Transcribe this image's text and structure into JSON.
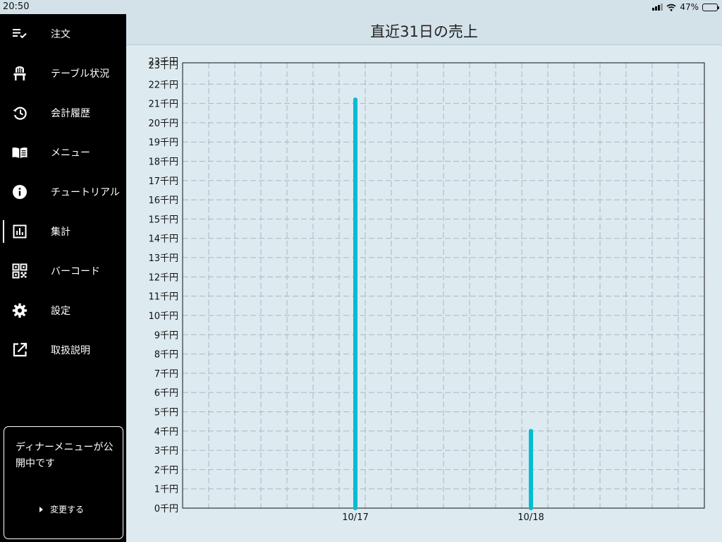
{
  "status_bar": {
    "time": "20:50",
    "battery": "47%",
    "battery_level": 0.47
  },
  "sidebar": {
    "items": [
      {
        "label": "注文",
        "icon": "order-checklist-icon"
      },
      {
        "label": "テーブル状況",
        "icon": "chair-icon"
      },
      {
        "label": "会計履歴",
        "icon": "history-icon"
      },
      {
        "label": "メニュー",
        "icon": "menu-book-icon"
      },
      {
        "label": "チュートリアル",
        "icon": "info-icon"
      },
      {
        "label": "集計",
        "icon": "bar-chart-icon",
        "active": true
      },
      {
        "label": "バーコード",
        "icon": "qr-code-icon"
      },
      {
        "label": "設定",
        "icon": "gear-icon"
      },
      {
        "label": "取扱説明",
        "icon": "external-link-icon"
      }
    ],
    "menu_card": {
      "message": "ディナーメニューが公開中です",
      "change_label": "変更する"
    }
  },
  "header": {
    "title": "直近31日の売上"
  },
  "chart_data": {
    "type": "bar",
    "title": "直近31日の売上",
    "xlabel": "",
    "ylabel": "",
    "ylim": [
      0,
      23000
    ],
    "y_ticks": [
      0,
      1000,
      2000,
      3000,
      4000,
      5000,
      6000,
      7000,
      8000,
      9000,
      10000,
      11000,
      12000,
      13000,
      14000,
      15000,
      16000,
      17000,
      18000,
      19000,
      20000,
      21000,
      22000,
      23000,
      23200
    ],
    "y_tick_labels": [
      "0千円",
      "1千円",
      "2千円",
      "3千円",
      "4千円",
      "5千円",
      "6千円",
      "7千円",
      "8千円",
      "9千円",
      "10千円",
      "11千円",
      "12千円",
      "13千円",
      "14千円",
      "15千円",
      "16千円",
      "17千円",
      "18千円",
      "19千円",
      "20千円",
      "21千円",
      "22千円",
      "23千円",
      "23千円"
    ],
    "x_tick_labels": [
      "10/17",
      "10/18"
    ],
    "categories": [
      "10/17",
      "10/18"
    ],
    "values": [
      21200,
      4000
    ],
    "grid": true,
    "bar_color": "#00bcd4"
  }
}
